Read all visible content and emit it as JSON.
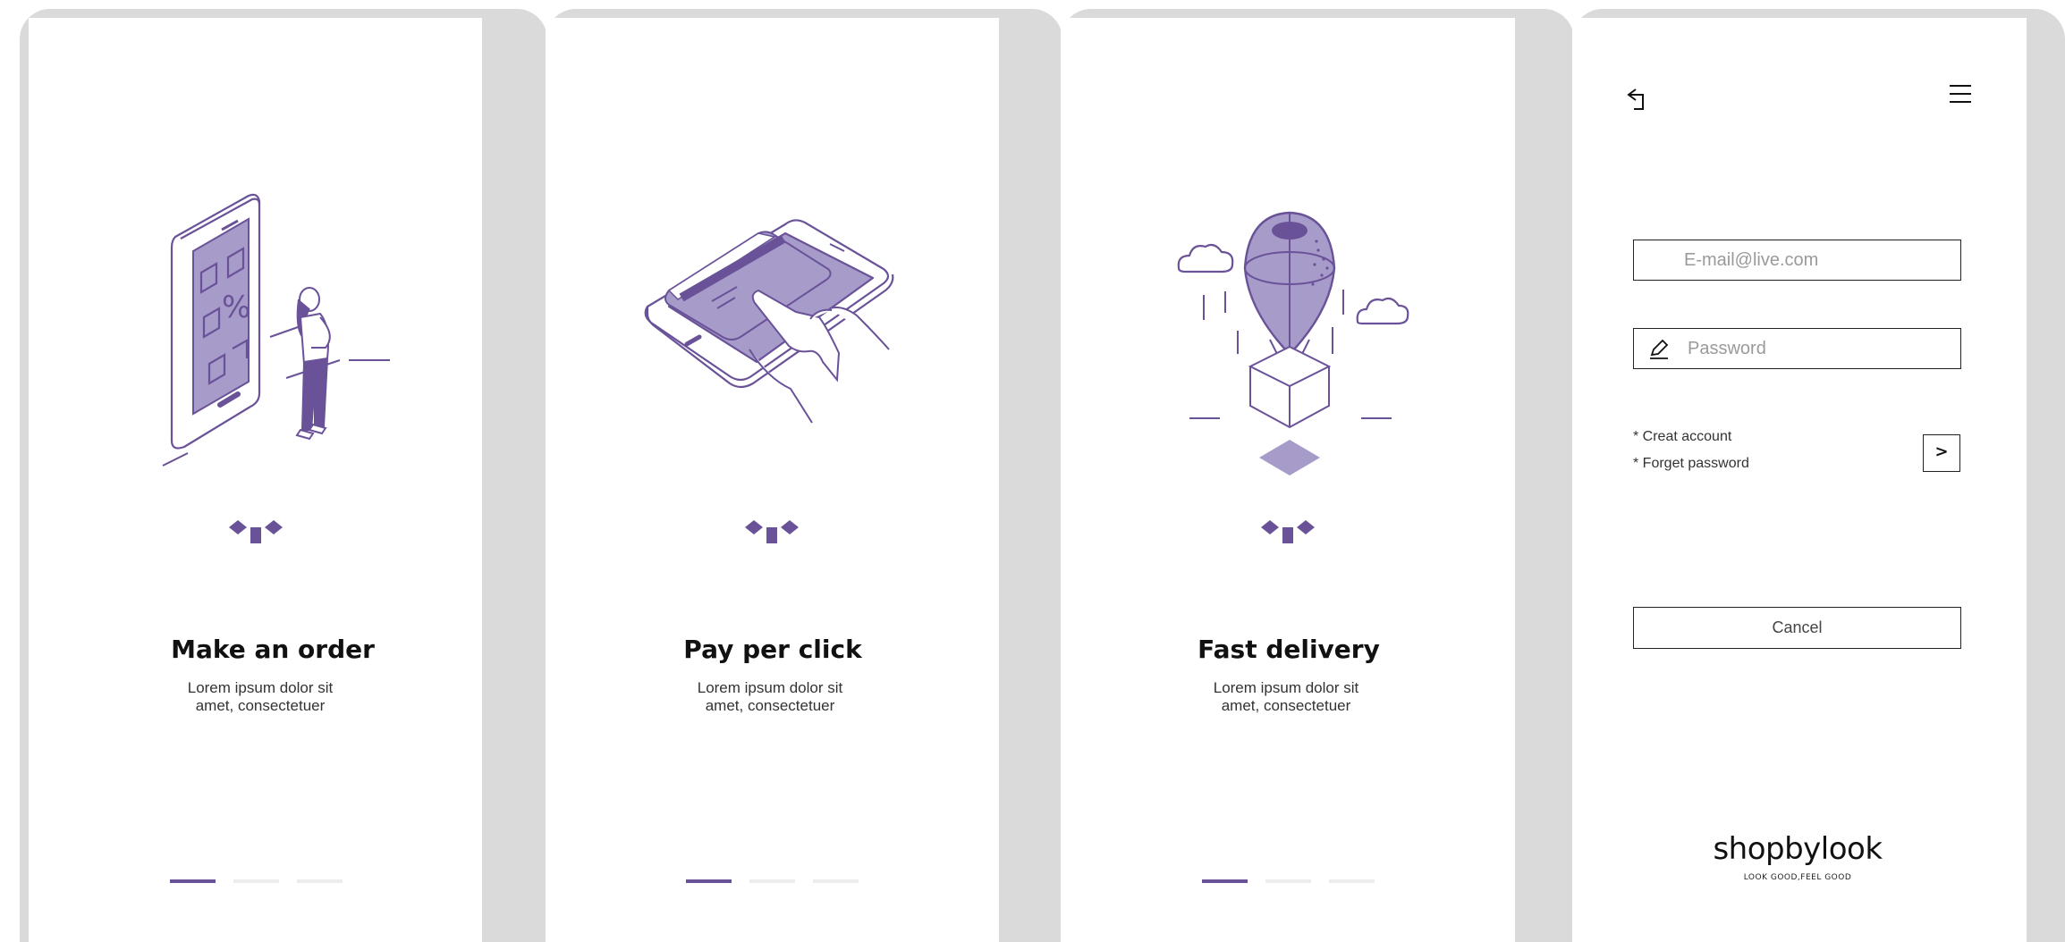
{
  "colors": {
    "accent": "#6a5299",
    "accent_light": "#a79bc9",
    "card_bg": "#dadada"
  },
  "screens": [
    {
      "illustration": "phone-shopping-woman-illustration",
      "title": "Make an order",
      "desc_line1": "Lorem ipsum dolor sit",
      "desc_line2": "amet, consectetuer",
      "active_page": 1,
      "total_pages": 3
    },
    {
      "illustration": "phone-tap-hand-illustration",
      "title": "Pay per click",
      "desc_line1": "Lorem ipsum dolor sit",
      "desc_line2": "amet, consectetuer",
      "active_page": 1,
      "total_pages": 3
    },
    {
      "illustration": "balloon-box-delivery-illustration",
      "title": "Fast delivery",
      "desc_line1": "Lorem ipsum dolor sit",
      "desc_line2": "amet, consectetuer",
      "active_page": 1,
      "total_pages": 3
    }
  ],
  "login": {
    "back_icon": "back-arrow-icon",
    "menu_icon": "hamburger-menu-icon",
    "email_placeholder": "E-mail@live.com",
    "password_placeholder": "Password",
    "password_icon": "pencil-icon",
    "create_account": "* Creat account",
    "forget_password": "* Forget password",
    "go_label": ">",
    "cancel_label": "Cancel",
    "brand": "shopbylook",
    "tagline": "LOOK GOOD,FEEL GOOD"
  }
}
